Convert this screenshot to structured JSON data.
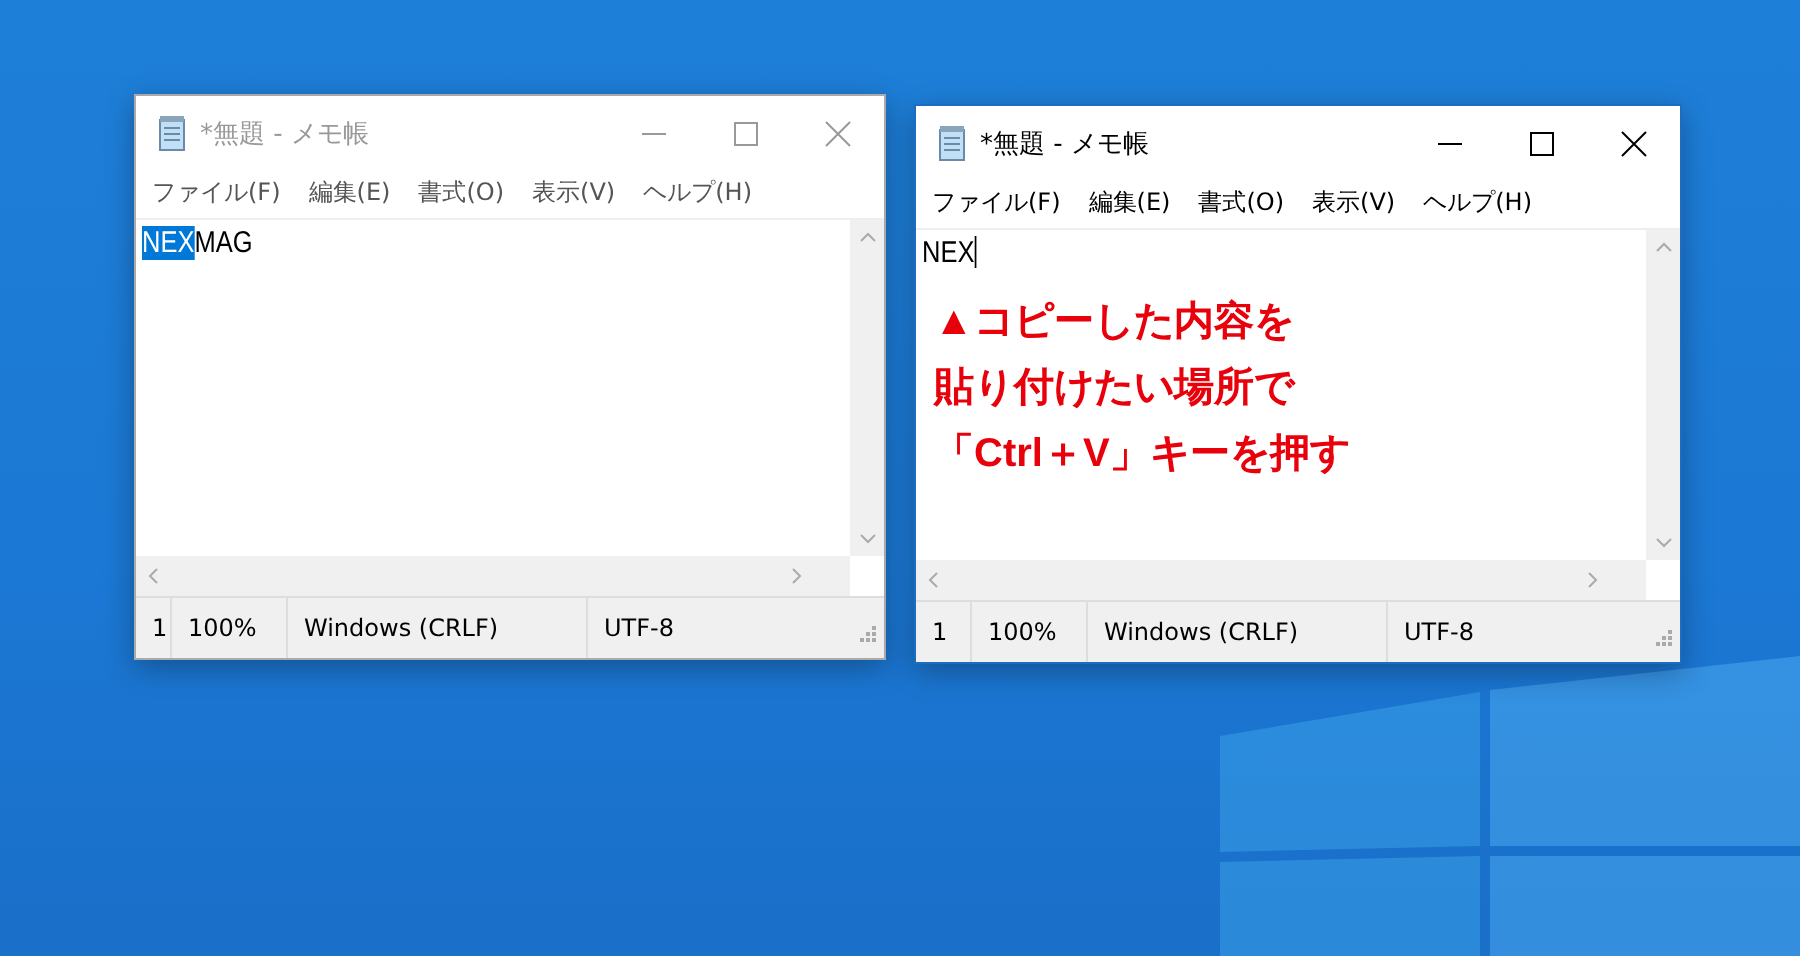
{
  "windows": [
    {
      "title": "*無題 - メモ帳",
      "active": false,
      "menu": [
        "ファイル(F)",
        "編集(E)",
        "書式(O)",
        "表示(V)",
        "ヘルプ(H)"
      ],
      "content": [
        {
          "text": "NEX",
          "selected": true
        },
        {
          "text": "MAG",
          "selected": false
        }
      ],
      "caret": false,
      "status": [
        "1",
        "100%",
        "Windows (CRLF)",
        "UTF-8"
      ]
    },
    {
      "title": "*無題 - メモ帳",
      "active": true,
      "menu": [
        "ファイル(F)",
        "編集(E)",
        "書式(O)",
        "表示(V)",
        "ヘルプ(H)"
      ],
      "content": [
        {
          "text": "NEX",
          "selected": false
        }
      ],
      "caret": true,
      "annotation": [
        "▲コピーした内容を",
        "貼り付けたい場所で",
        "「Ctrl＋V」キーを押す"
      ],
      "status": [
        "1",
        "100%",
        "Windows (CRLF)",
        "UTF-8"
      ]
    }
  ]
}
